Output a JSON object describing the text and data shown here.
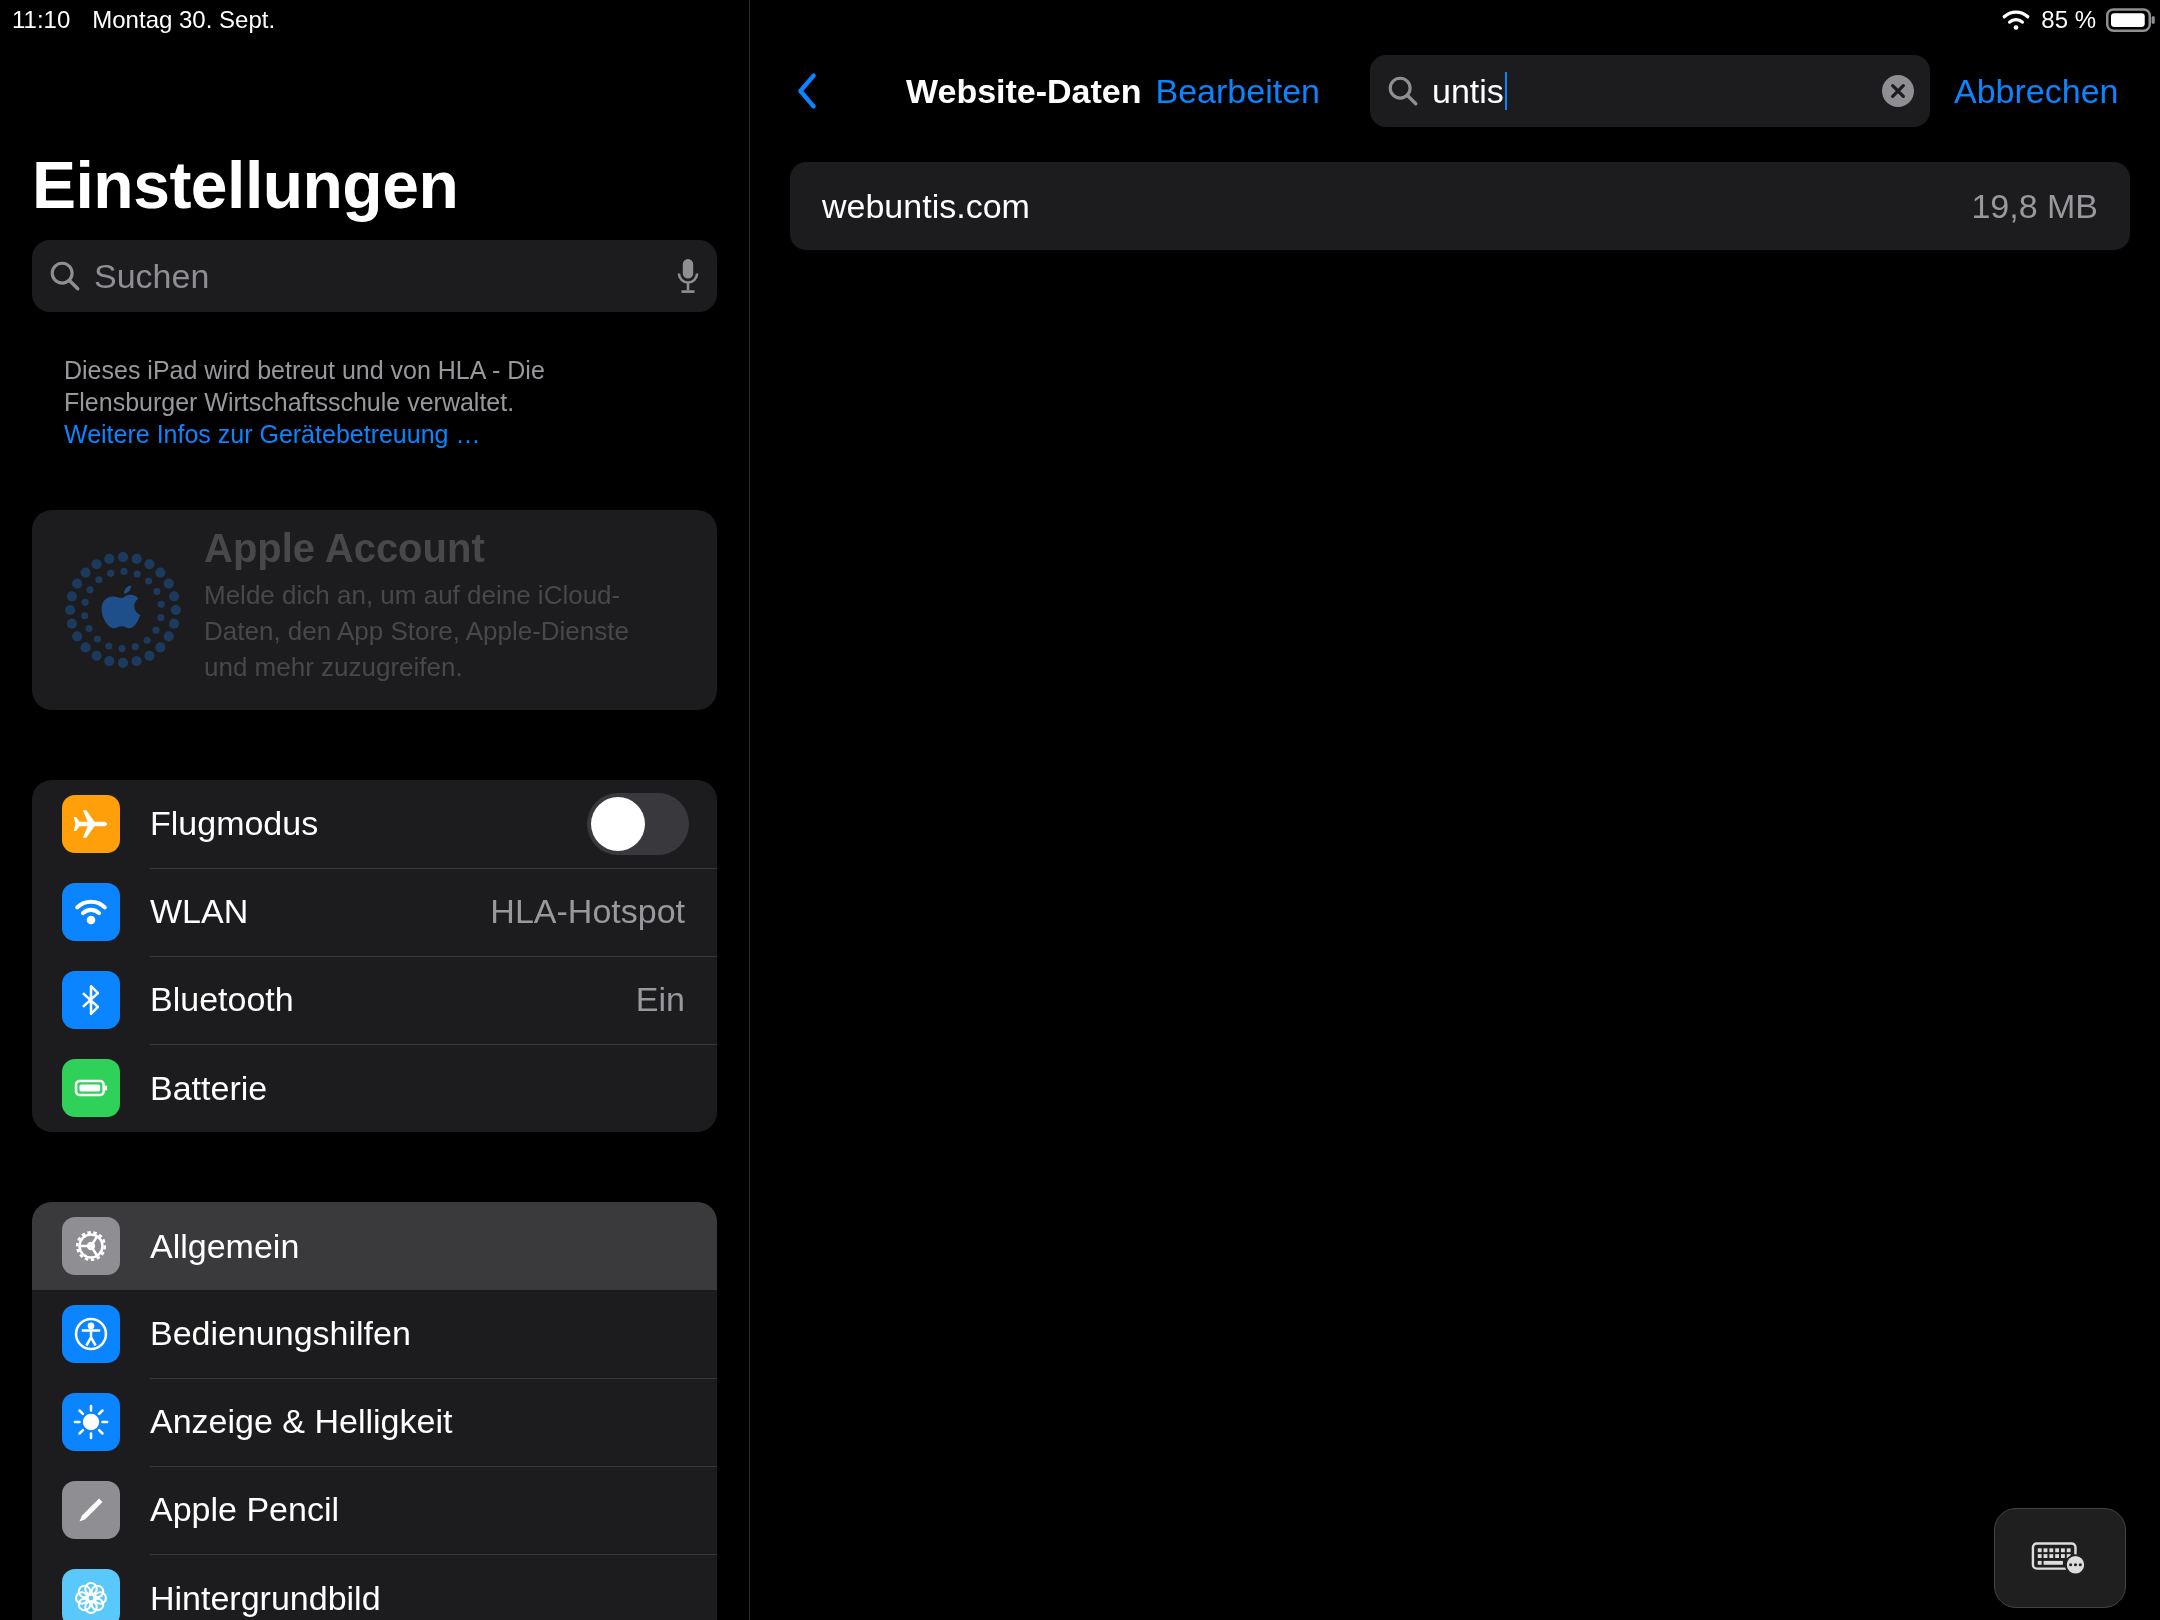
{
  "status_bar": {
    "time": "11:10",
    "date": "Montag 30. Sept.",
    "battery_percent": "85 %"
  },
  "sidebar": {
    "title": "Einstellungen",
    "search": {
      "placeholder": "Suchen"
    },
    "managed_notice": {
      "text": "Dieses iPad wird betreut und von HLA - Die Flensburger Wirtschaftsschule verwaltet.",
      "link": "Weitere Infos zur Gerätebetreuung …"
    },
    "account_card": {
      "title": "Apple Account",
      "subtitle": "Melde dich an, um auf deine iCloud-Daten, den App Store, Apple-Dienste und mehr zuzugreifen.",
      "disabled": true
    },
    "groups": [
      [
        {
          "kind": "toggle",
          "label": "Flugmodus",
          "color": "#ff9f0a",
          "on": false,
          "selected": false
        },
        {
          "kind": "value",
          "label": "WLAN",
          "value": "HLA-Hotspot",
          "color": "#0a84ff",
          "selected": false
        },
        {
          "kind": "value",
          "label": "Bluetooth",
          "value": "Ein",
          "color": "#0a84ff",
          "selected": false
        },
        {
          "kind": "plain",
          "label": "Batterie",
          "color": "#30d158",
          "selected": false
        }
      ],
      [
        {
          "kind": "plain",
          "label": "Allgemein",
          "color": "#8e8e93",
          "selected": true
        },
        {
          "kind": "plain",
          "label": "Bedienungshilfen",
          "color": "#0a84ff",
          "selected": false
        },
        {
          "kind": "plain",
          "label": "Anzeige & Helligkeit",
          "color": "#0a84ff",
          "selected": false
        },
        {
          "kind": "plain",
          "label": "Apple Pencil",
          "color": "#8e8e93",
          "selected": false
        },
        {
          "kind": "plain",
          "label": "Hintergrundbild",
          "color": "#5ac8fa",
          "selected": false
        }
      ]
    ]
  },
  "detail": {
    "title": "Website-Daten",
    "edit_button": "Bearbeiten",
    "search": {
      "value": "untis"
    },
    "cancel_button": "Abbrechen",
    "results": [
      {
        "domain": "webuntis.com",
        "size": "19,8 MB"
      }
    ]
  }
}
